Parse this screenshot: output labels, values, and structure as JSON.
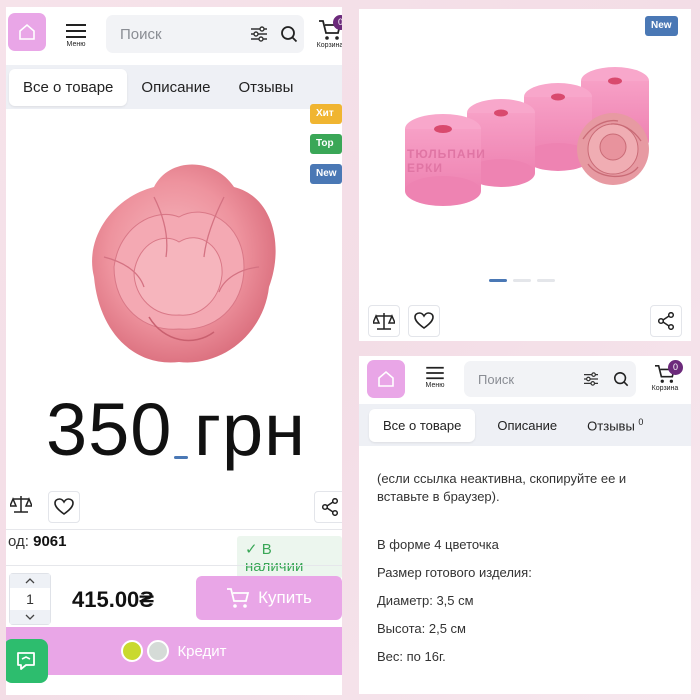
{
  "colors": {
    "accent": "#e9a6e7",
    "badge_new": "#4a78b5",
    "badge_hit": "#f0b531",
    "badge_top": "#3aa757",
    "stock_green": "#3aa757"
  },
  "header": {
    "menu_label": "Меню",
    "search_placeholder": "Поиск",
    "cart_label": "Корзина",
    "cart_count": "0"
  },
  "tabs": [
    {
      "label": "Все о товаре",
      "active": true
    },
    {
      "label": "Описание"
    },
    {
      "label": "Отзывы",
      "count": "0"
    }
  ],
  "left": {
    "badges": [
      "Хит",
      "Top",
      "New"
    ],
    "price_overlay": "350 грн",
    "code_label": "од:",
    "code_value": "9061",
    "stock_label": "В наличии",
    "quantity": "1",
    "total": "415.00₴",
    "buy_label": "Купить",
    "credit_label": "Кредит"
  },
  "top_right": {
    "badge": "New",
    "mold_text": "ТЮЛЬПАНИ ЕРКИ",
    "carousel": {
      "count": 3,
      "active": 0
    }
  },
  "bottom_right": {
    "description": [
      "(если ссылка неактивна, скопируйте ее и вставьте в браузер).",
      "",
      "В форме 4 цветочка",
      "Размер готового изделия:",
      "Диаметр: 3,5 см",
      "Высота: 2,5 см",
      "Вес: по 16г."
    ]
  }
}
